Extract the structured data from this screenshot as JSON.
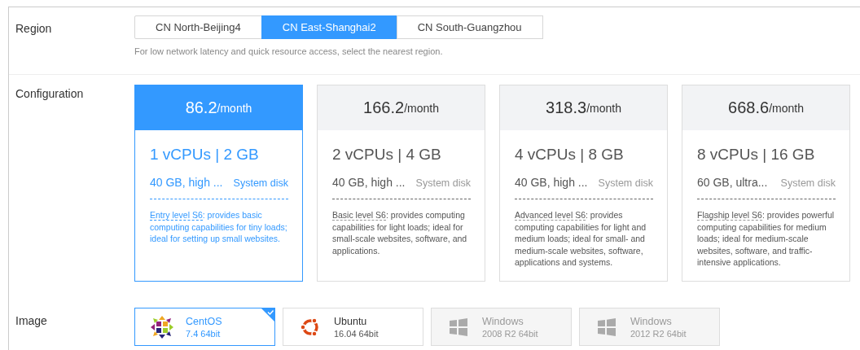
{
  "region": {
    "label": "Region",
    "options": [
      {
        "label": "CN North-Beijing4",
        "selected": false
      },
      {
        "label": "CN East-Shanghai2",
        "selected": true
      },
      {
        "label": "CN South-Guangzhou",
        "selected": false
      }
    ],
    "hint": "For low network latency and quick resource access, select the nearest region."
  },
  "configuration": {
    "label": "Configuration",
    "plans": [
      {
        "price": "86.2",
        "unit": "/month",
        "spec": "1 vCPUs | 2 GB",
        "disk": "40 GB, high ...",
        "disk_label": "System disk",
        "term": "Entry level S6",
        "description": ": provides basic computing capabilities for tiny loads; ideal for setting up small websites.",
        "selected": true
      },
      {
        "price": "166.2",
        "unit": "/month",
        "spec": "2 vCPUs | 4 GB",
        "disk": "40 GB, high ...",
        "disk_label": "System disk",
        "term": "Basic level S6",
        "description": ": provides computing capabilities for light loads; ideal for small-scale websites, software, and applications.",
        "selected": false
      },
      {
        "price": "318.3",
        "unit": "/month",
        "spec": "4 vCPUs | 8 GB",
        "disk": "40 GB, high ...",
        "disk_label": "System disk",
        "term": "Advanced level S6",
        "description": ": provides computing capabilities for light and medium loads; ideal for small- and medium-scale websites, software, applications and systems.",
        "selected": false
      },
      {
        "price": "668.6",
        "unit": "/month",
        "spec": "8 vCPUs | 16 GB",
        "disk": "60 GB, ultra...",
        "disk_label": "System disk",
        "term": "Flagship level S6",
        "description": ": provides powerful computing capabilities for medium loads; ideal for medium-scale websites, software, and traffic-intensive applications.",
        "selected": false
      }
    ]
  },
  "image": {
    "label": "Image",
    "options": [
      {
        "kind": "centos",
        "name": "CentOS",
        "version": "7.4 64bit",
        "selected": true,
        "disabled": false
      },
      {
        "kind": "ubuntu",
        "name": "Ubuntu",
        "version": "16.04 64bit",
        "selected": false,
        "disabled": false
      },
      {
        "kind": "windows",
        "name": "Windows",
        "version": "2008 R2 64bit",
        "selected": false,
        "disabled": true
      },
      {
        "kind": "windows",
        "name": "Windows",
        "version": "2012 R2 64bit",
        "selected": false,
        "disabled": true
      }
    ]
  }
}
